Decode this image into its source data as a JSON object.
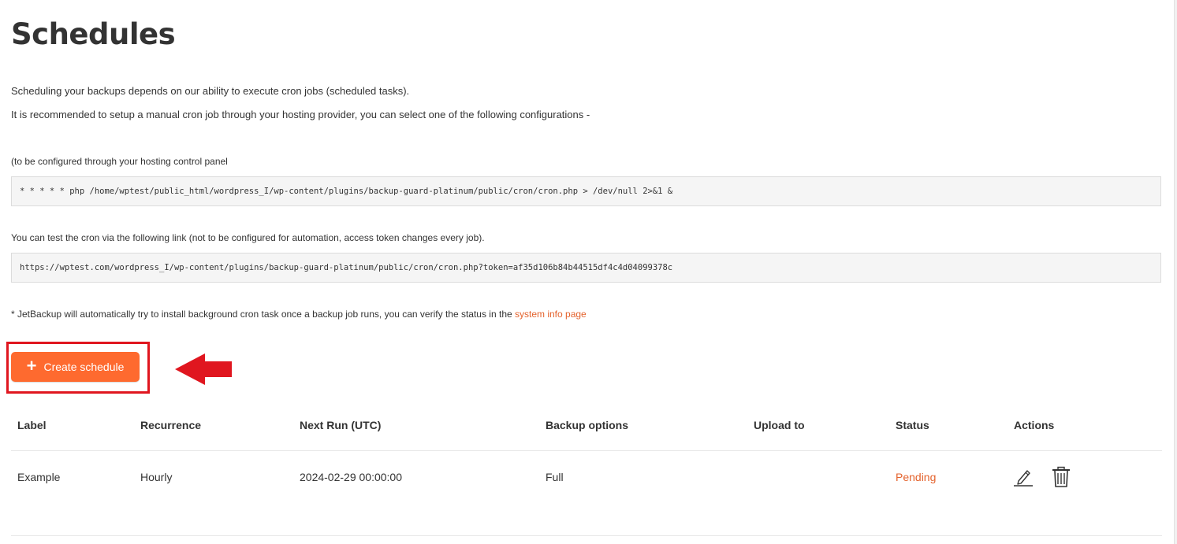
{
  "page": {
    "title": "Schedules",
    "intro_line1": "Scheduling your backups depends on our ability to execute cron jobs (scheduled tasks).",
    "intro_line2": "It is recommended to setup a manual cron job through your hosting provider, you can select one of the following configurations -",
    "cron_panel_label": "(to be configured through your hosting control panel",
    "cron_command": "* * * * * php /home/wptest/public_html/wordpress_I/wp-content/plugins/backup-guard-platinum/public/cron/cron.php > /dev/null 2>&1 &",
    "test_label": "You can test the cron via the following link (not to be configured for automation, access token changes every job).",
    "test_url": "https://wptest.com/wordpress_I/wp-content/plugins/backup-guard-platinum/public/cron/cron.php?token=af35d106b84b44515df4c4d04099378c",
    "note_prefix": "* JetBackup will automatically try to install background cron task once a backup job runs, you can verify the status in the ",
    "note_link": "system info page"
  },
  "create_button": {
    "icon": "+",
    "label": "Create schedule"
  },
  "table": {
    "headers": {
      "label": "Label",
      "recurrence": "Recurrence",
      "next_run": "Next Run (UTC)",
      "backup_options": "Backup options",
      "upload_to": "Upload to",
      "status": "Status",
      "actions": "Actions"
    },
    "rows": [
      {
        "label": "Example",
        "recurrence": "Hourly",
        "next_run": "2024-02-29 00:00:00",
        "backup_options": "Full",
        "upload_to": "",
        "status": "Pending"
      }
    ]
  },
  "colors": {
    "accent": "#fe6a2f",
    "status_pending": "#e4622c",
    "annotation_red": "#e0161f"
  },
  "icons": {
    "edit": "pencil-icon",
    "delete": "trash-icon",
    "create": "plus-icon",
    "annotation": "arrow-left-icon"
  }
}
